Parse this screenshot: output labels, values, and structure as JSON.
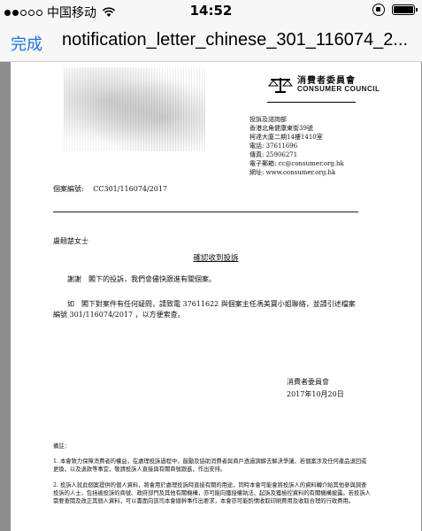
{
  "status_bar": {
    "carrier": "中国移动",
    "time": "14:52",
    "signal_bars": 2,
    "battery_level": 1.0
  },
  "navbar": {
    "done_label": "完成",
    "title": "notification_letter_chinese_301_116074_2...",
    "accent_color": "#1a74e8"
  },
  "document": {
    "logo": {
      "name_zh": "消費者委員會",
      "name_en": "CONSUMER COUNCIL"
    },
    "address": [
      "投訴及諮詢部",
      "香港北角健康東街39號",
      "柯達大廈二期14樓1410室",
      "電話: 37611696",
      "傳真: 25906271",
      "電子郵箱: cc@consumer.org.hk",
      "網址: www.consumer.org.hk"
    ],
    "case_label": "個案編號:",
    "case_number": "CC301/116074/2017",
    "recipient": "盧翹楚女士",
    "subject": "確認收到投訴",
    "paragraph1": "謝謝　閣下的投訴，我們會儘快跟進有關個案。",
    "paragraph2": "如　閣下對案件有任何疑問，請致電 37611622 與個案主任馮美寶小姐聯絡，並請引述檔案編號 301/116074/2017 ，以方便索查。",
    "signature": "消費者委員會",
    "date": "2017年10月20日",
    "notes_heading": "備註：",
    "note1": "1. 本會致力保障消費者的權益，在處理投訴過程中，鼓勵及協助消費者與商戶透過調解去解決爭議，若個案涉及任何產品退回或更換，以及退款等事宜，敬請投訴人直接與有關商號跟進，作出安排。",
    "note2": "2. 投訴人就此個案提供的個人資料，將會用於處理投訴時直接有關的用途，同時本會可能會將投訴人的資料轉介給其他參與調查投訴的人士，包括被投訴的商號、政府部門及其他有關機構，亦可能向獲授權執法、起訴及獲檢控資料的有關機構披露。若投訴人需要查閱及改正其個人資料，可以書面向該司本會總幹事作出要求，本會亦可能酌情收取印刷費用及收取合理的行政費用。"
  }
}
